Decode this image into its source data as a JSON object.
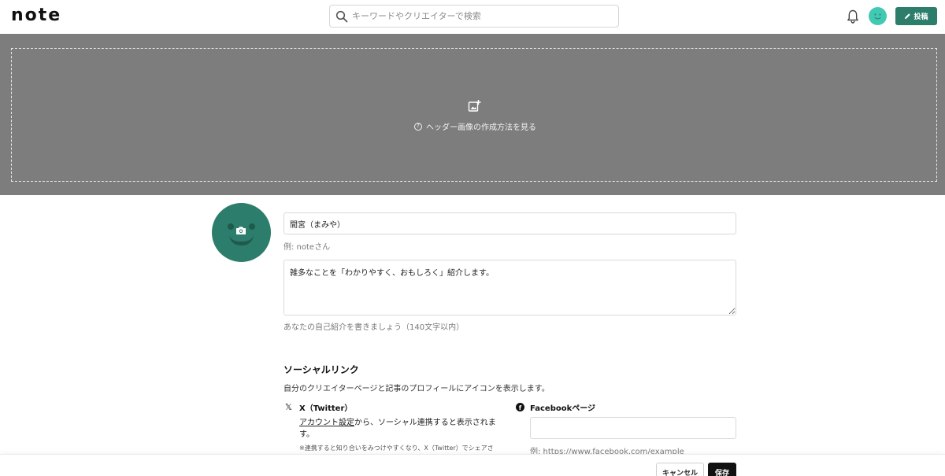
{
  "header": {
    "logo_text": "note",
    "search_placeholder": "キーワードやクリエイターで検索",
    "post_button_label": "投稿"
  },
  "header_image": {
    "help_text": "ヘッダー画像の作成方法を見る"
  },
  "profile": {
    "name_value": "間宮（まみや）",
    "name_hint": "例: noteさん",
    "bio_value": "雑多なことを「わかりやすく、おもしろく」紹介します。",
    "bio_hint": "あなたの自己紹介を書きましょう（140文字以内）"
  },
  "social": {
    "title": "ソーシャルリンク",
    "description": "自分のクリエイターページと記事のプロフィールにアイコンを表示します。",
    "twitter": {
      "label": "X（Twitter）",
      "link_text": "アカウント設定",
      "text_after_link": "から、ソーシャル連携すると表示されます。",
      "note": "※連携すると知り合いをみつけやすくなり、X（Twitter）でシェアさ"
    },
    "facebook": {
      "label": "Facebookページ",
      "value": "",
      "hint": "例: https://www.facebook.com/example"
    }
  },
  "actions": {
    "cancel_label": "キャンセル",
    "save_label": "保存"
  },
  "colors": {
    "brand_green": "#2c7d6b",
    "avatar_mint": "#41c9b4",
    "header_gray": "#7d7d7d"
  }
}
